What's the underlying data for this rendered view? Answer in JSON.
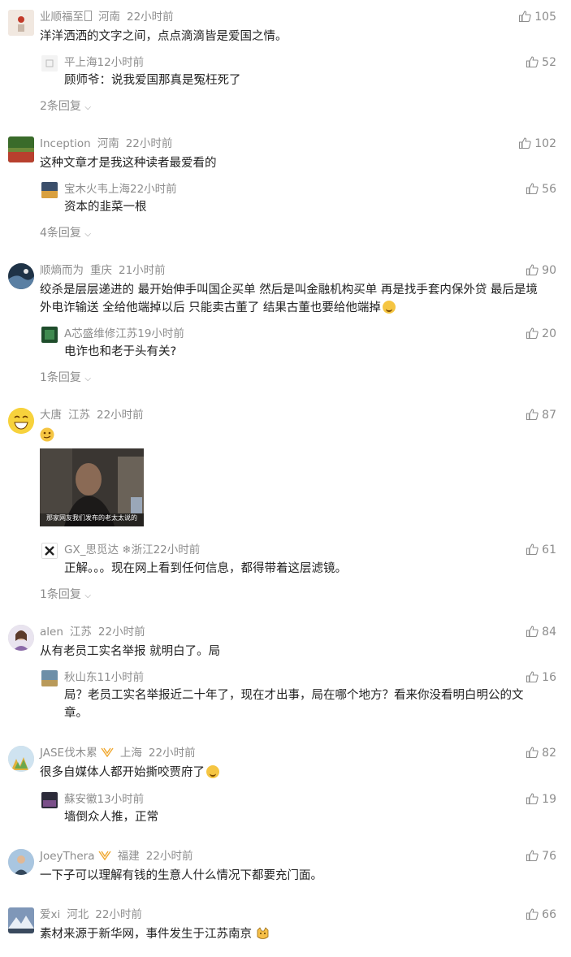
{
  "comments": [
    {
      "user": "业顺福至",
      "location": "河南",
      "time": "22小时前",
      "likes": "105",
      "text": "洋洋洒洒的文字之间，点点滴滴皆是爱国之情。",
      "reply": {
        "user": "平",
        "location": "上海",
        "time": "12小时前",
        "likes": "52",
        "text": "顾师爷：说我爱国那真是冤枉死了"
      },
      "more": "2条回复"
    },
    {
      "user": "Inception",
      "location": "河南",
      "time": "22小时前",
      "likes": "102",
      "text": "这种文章才是我这种读者最爱看的",
      "reply": {
        "user": "宝木火韦",
        "location": "上海",
        "time": "22小时前",
        "likes": "56",
        "text": "资本的韭菜一根"
      },
      "more": "4条回复"
    },
    {
      "user": "顺熵而为",
      "location": "重庆",
      "time": "21小时前",
      "likes": "90",
      "text_line1": "绞杀是层层递进的 最开始伸手叫国企买单 然后是叫金融机构买单 再是找手套内保外贷 最后是境",
      "text_line2": "外电诈输送 全给他端掉以后 只能卖古董了 结果古董也要给他端掉",
      "reply": {
        "user": "A芯盛维修",
        "location": "江苏",
        "time": "19小时前",
        "likes": "20",
        "text": "电诈也和老于头有关?"
      },
      "more": "1条回复"
    },
    {
      "user": "大唐",
      "location": "江苏",
      "time": "22小时前",
      "likes": "87",
      "reply": {
        "user": "GX_思觅达",
        "user_suffix": "❄",
        "location": "浙江",
        "time": "22小时前",
        "likes": "61",
        "text": "正解。。。现在网上看到任何信息，都得带着这层滤镜。"
      },
      "more": "1条回复"
    },
    {
      "user": "alen",
      "location": "江苏",
      "time": "22小时前",
      "likes": "84",
      "text": "从有老员工实名举报 就明白了。局",
      "reply": {
        "user": "秋",
        "location": "山东",
        "time": "11小时前",
        "likes": "16",
        "text_line1": "局？老员工实名举报近二十年了，现在才出事，局在哪个地方？看来你没看明白明公的文",
        "text_line2": "章。"
      }
    },
    {
      "user": "JASE伐木累",
      "location": "上海",
      "time": "22小时前",
      "likes": "82",
      "text": "很多自媒体人都开始撕咬贾府了",
      "reply": {
        "user": "蘇",
        "location": "安徽",
        "time": "13小时前",
        "likes": "19",
        "text": "墙倒众人推，正常"
      }
    },
    {
      "user": "JoeyThera",
      "location": "福建",
      "time": "22小时前",
      "likes": "76",
      "text": "一下子可以理解有钱的生意人什么情况下都要充门面。"
    },
    {
      "user": "爱xi",
      "location": "河北",
      "time": "22小时前",
      "likes": "66",
      "text": "素材来源于新华网，事件发生于江苏南京"
    }
  ],
  "photo_caption": "那家网友我们发布的老太太说的"
}
